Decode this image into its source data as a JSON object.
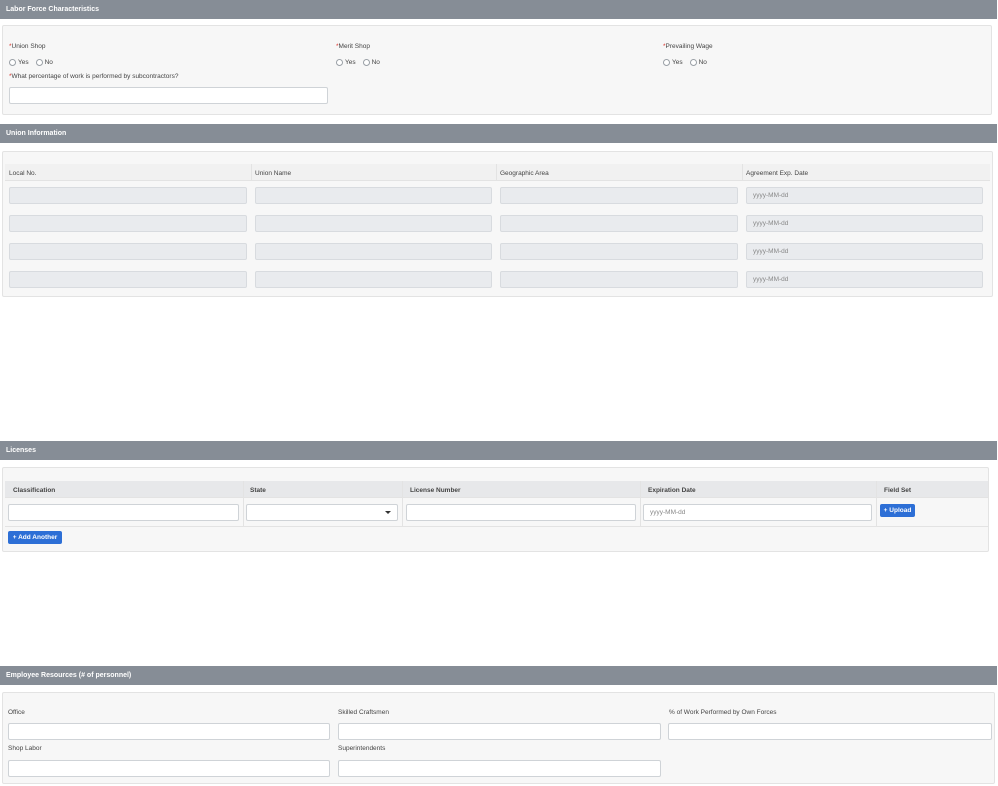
{
  "labor": {
    "title": "Labor Force Characteristics",
    "union_shop": "Union Shop",
    "merit_shop": "Merit Shop",
    "prevailing_wage": "Prevailing Wage",
    "yes": "Yes",
    "no": "No",
    "subcontract_question": "What percentage of work is performed by subcontractors?",
    "required_mark": "*"
  },
  "union": {
    "title": "Union Information",
    "columns": [
      "Local No.",
      "Union Name",
      "Geographic Area",
      "Agreement Exp. Date"
    ],
    "date_placeholder": "yyyy-MM-dd"
  },
  "licenses": {
    "title": "Licenses",
    "columns": [
      "Classification",
      "State",
      "License Number",
      "Expiration Date",
      "Field Set"
    ],
    "date_placeholder": "yyyy-MM-dd",
    "upload_label": "+ Upload",
    "add_another_label": "+ Add Another"
  },
  "employees": {
    "title": "Employee Resources (# of personnel)",
    "office": "Office",
    "skilled": "Skilled Craftsmen",
    "own_forces": "% of Work Performed by Own Forces",
    "shop_labor": "Shop Labor",
    "superintendents": "Superintendents"
  }
}
